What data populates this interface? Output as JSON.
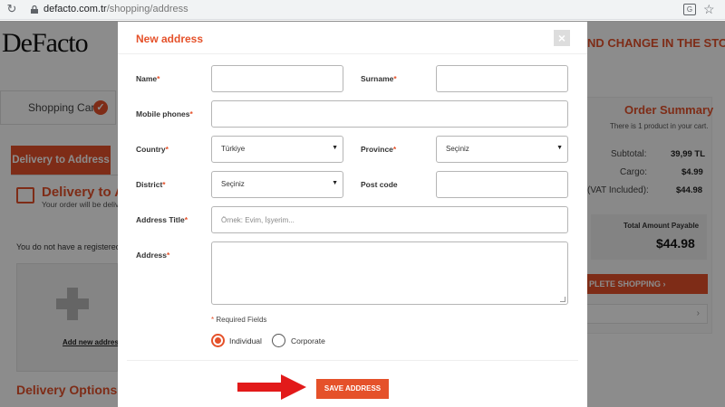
{
  "browser": {
    "url_domain": "defacto.com.tr",
    "url_path": "/shopping/address",
    "reload_icon": "reload-icon",
    "lock_icon": "lock-icon",
    "translate_icon": "translate-icon",
    "bookmark_icon": "star-icon"
  },
  "page": {
    "logo": "DeFacto",
    "promo": "ND CHANGE IN THE STORE",
    "steps": {
      "cart": "Shopping Cart"
    },
    "tab_delivery": "Delivery to Address",
    "delivery_title": "Delivery to Add",
    "delivery_sub": "Your order will be delive",
    "no_address": "You do not have a registered a",
    "add_new": "Add new address",
    "delivery_options": "Delivery Options",
    "summary": {
      "title": "Order Summary",
      "count_text": "There is 1 product in your cart.",
      "rows": [
        {
          "label": "Subtotal:",
          "value": "39,99 TL"
        },
        {
          "label": "Cargo:",
          "value": "$4.99"
        },
        {
          "label": "(VAT Included):",
          "value": "$44.98"
        }
      ],
      "total_label": "Total Amount Payable",
      "total_value": "$44.98",
      "complete_button": "PLETE SHOPPING"
    }
  },
  "modal": {
    "title": "New address",
    "fields": {
      "name_label": "Name",
      "surname_label": "Surname",
      "mobile_label": "Mobile phones",
      "country_label": "Country",
      "country_value": "Türkiye",
      "province_label": "Province",
      "province_value": "Seçiniz",
      "district_label": "District",
      "district_value": "Seçiniz",
      "postcode_label": "Post code",
      "address_title_label": "Address Title",
      "address_title_placeholder": "Örnek: Evim, İşyerim...",
      "address_label": "Address",
      "required_asterisk": "*"
    },
    "required_note": "Required Fields",
    "radios": {
      "individual": "Individual",
      "corporate": "Corporate",
      "selected": "individual"
    },
    "save_button": "SAVE ADDRESS"
  },
  "colors": {
    "accent": "#e5512a",
    "arrow": "#e21a1a"
  }
}
